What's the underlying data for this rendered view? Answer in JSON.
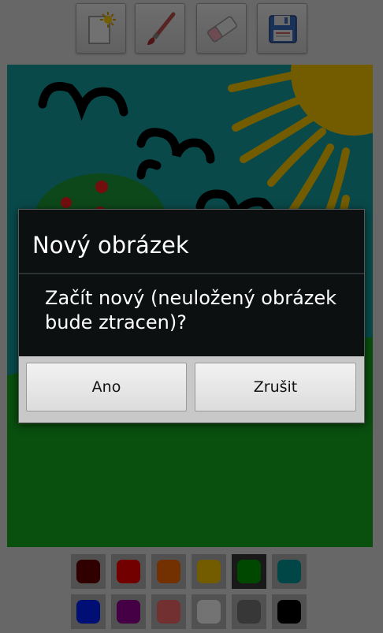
{
  "toolbar": {
    "buttons": [
      {
        "name": "new-image",
        "icon": "new-page-icon"
      },
      {
        "name": "brush",
        "icon": "brush-icon"
      },
      {
        "name": "eraser",
        "icon": "eraser-icon"
      },
      {
        "name": "save",
        "icon": "floppy-disk-icon"
      }
    ]
  },
  "palette": {
    "colors": [
      "#6b0000",
      "#ff0000",
      "#ff6a00",
      "#ffcc00",
      "#00a000",
      "#009c9c",
      "#0022ff",
      "#990099",
      "#ff6b6b",
      "#ffffff",
      "#7a7a7a",
      "#000000"
    ],
    "selected_color": "#00a000"
  },
  "dialog": {
    "title": "Nový obrázek",
    "message": "Začít nový (neuložený obrázek bude ztracen)?",
    "confirm_label": "Ano",
    "cancel_label": "Zrušit"
  }
}
